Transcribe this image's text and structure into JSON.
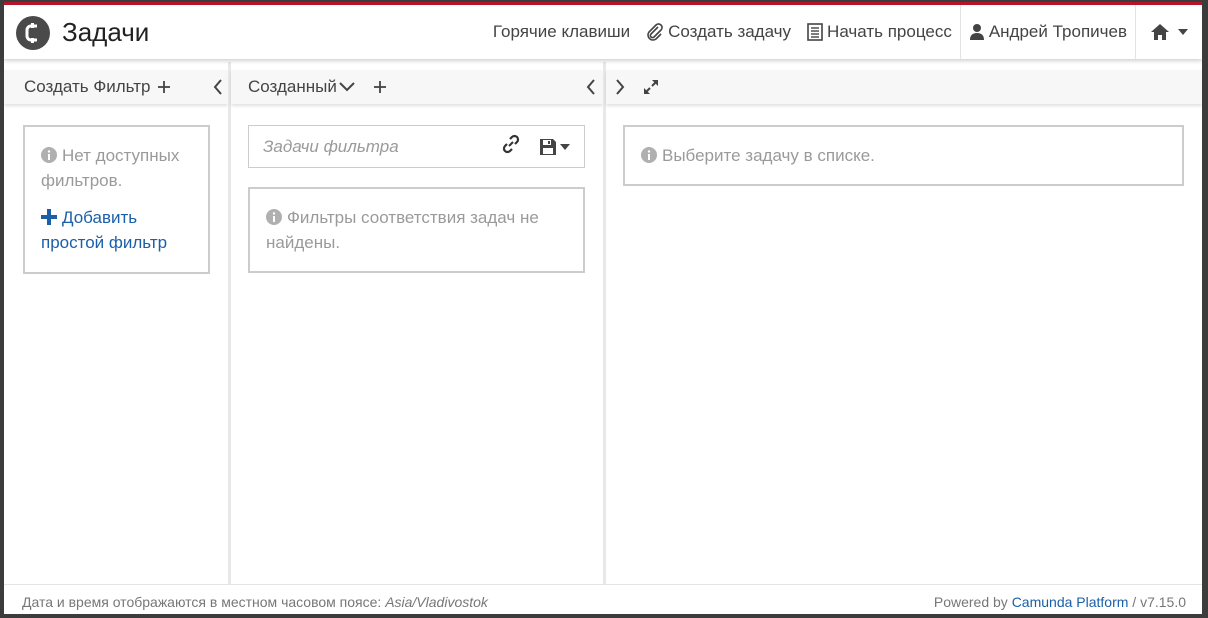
{
  "app": {
    "title": "Задачи"
  },
  "nav": {
    "hotkeys": "Горячие клавиши",
    "create_task": "Создать задачу",
    "start_process": "Начать процесс",
    "user": "Андрей Тропичев"
  },
  "filters": {
    "header": "Создать Фильтр",
    "empty_message": "Нет доступных фильтров.",
    "add_link": "Добавить простой фильтр"
  },
  "list": {
    "sort_label": "Созданный",
    "search_placeholder": "Задачи фильтра",
    "empty_message": "Фильтры соответствия задач не найдены."
  },
  "task": {
    "empty_message": "Выберите задачу в списке."
  },
  "footer": {
    "tz_text": "Дата и время отображаются в местном часовом поясе: ",
    "tz_value": "Asia/Vladivostok",
    "powered_by": "Powered by ",
    "platform": "Camunda Platform",
    "version": " / v7.15.0"
  },
  "colors": {
    "accent": "#b5152b",
    "link": "#1a5fa8",
    "muted_text": "#9a9a9a"
  },
  "icons": [
    "camunda-logo-icon",
    "paperclip-icon",
    "list-icon",
    "user-icon",
    "home-icon",
    "caret-down-icon",
    "plus-icon",
    "chevron-left-icon",
    "chevron-right-icon",
    "chevron-down-icon",
    "expand-icon",
    "link-icon",
    "save-icon",
    "info-icon"
  ]
}
